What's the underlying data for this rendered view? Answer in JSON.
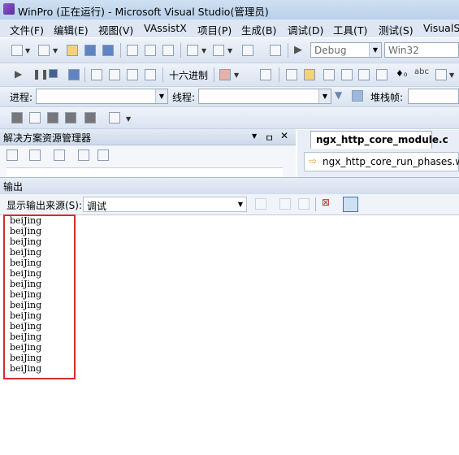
{
  "window": {
    "title": "WinPro (正在运行) - Microsoft Visual Studio(管理员)"
  },
  "menu": [
    "文件(F)",
    "编辑(E)",
    "视图(V)",
    "VAssistX",
    "项目(P)",
    "生成(B)",
    "调试(D)",
    "工具(T)",
    "测试(S)",
    "VisualSV"
  ],
  "toolbar": {
    "config": "Debug",
    "platform": "Win32",
    "hex_label": "十六进制"
  },
  "debugbar": {
    "process_label": "进程:",
    "thread_label": "线程:",
    "stack_label": "堆栈帧:"
  },
  "solution_explorer": {
    "title": "解决方案资源管理器",
    "pin": "ㅁ",
    "close": "✕",
    "dropdown": "▼"
  },
  "editor": {
    "tab": "ngx_http_core_module.c",
    "nav_function": "ngx_http_core_run_phases.wh"
  },
  "output": {
    "title": "输出",
    "source_label": "显示输出来源(S):",
    "source_value": "调试",
    "lines": [
      "beiJing",
      "beiJing",
      "beiJing",
      "beiJing",
      "beiJing",
      "beiJing",
      "beiJing",
      "beiJing",
      "beiJing",
      "beiJing",
      "beiJing",
      "beiJing",
      "beiJing",
      "beiJing",
      "beiJing"
    ]
  },
  "colors": {
    "highlight": "#d62b2b",
    "chrome": "#dde6f2"
  }
}
